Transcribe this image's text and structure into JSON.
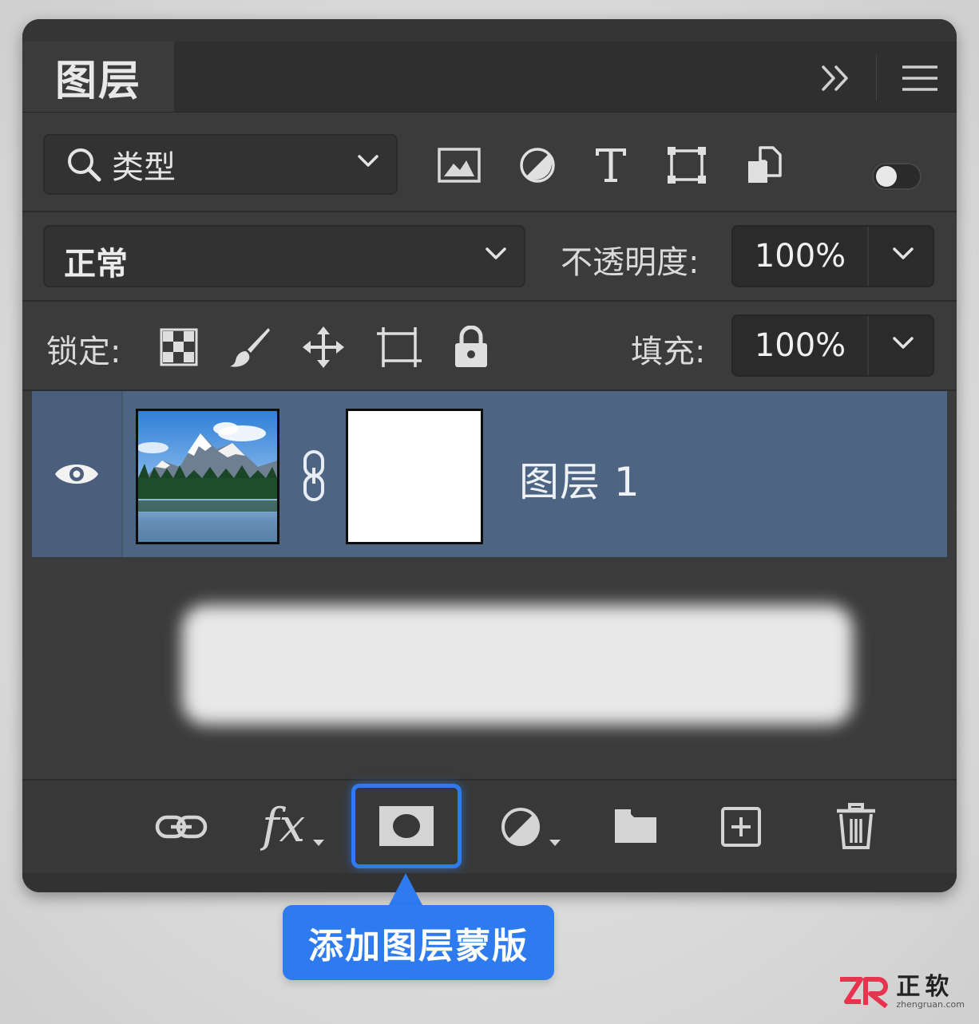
{
  "panel": {
    "tab_title": "图层"
  },
  "filter": {
    "label": "类型"
  },
  "blend": {
    "mode": "正常",
    "opacity_label": "不透明度:",
    "opacity_value": "100%"
  },
  "lock": {
    "label": "锁定:",
    "fill_label": "填充:",
    "fill_value": "100%"
  },
  "layers": [
    {
      "name": "图层 1",
      "visible": true,
      "selected": true,
      "has_mask": true
    }
  ],
  "callout": {
    "text": "添加图层蒙版"
  },
  "watermark": {
    "brand_cn": "正软",
    "brand_en": "zhengruan.com",
    "colors": {
      "accent_pink": "#e8334f",
      "accent_blue": "#2e7bf0"
    }
  },
  "colors": {
    "panel_bg": "#3b3b3b",
    "selected_row": "#4d6482",
    "highlight": "#2e7bf0"
  }
}
